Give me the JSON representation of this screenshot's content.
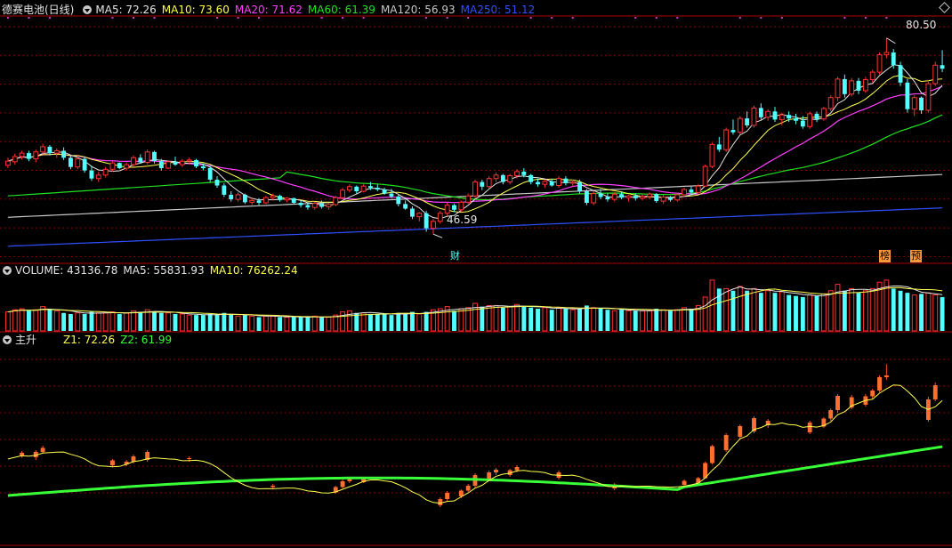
{
  "header_main": {
    "title": "德赛电池(日线)",
    "ma_labels": [
      {
        "text": "MA5: 72.26",
        "color": "#e6e6e6"
      },
      {
        "text": "MA10: 73.60",
        "color": "#ffff50"
      },
      {
        "text": "MA20: 71.62",
        "color": "#ff40ff"
      },
      {
        "text": "MA60: 61.39",
        "color": "#20e020"
      },
      {
        "text": "MA120: 56.93",
        "color": "#c8c8c8"
      },
      {
        "text": "MA250: 51.12",
        "color": "#3050ff"
      }
    ]
  },
  "header_volume": {
    "title": "VOLUME: 43136.78",
    "ma5": "MA5: 55831.93",
    "ma10": "MA10: 76262.24"
  },
  "header_indicator": {
    "title": "主升",
    "z1": "Z1: 72.26",
    "z2": "Z2: 61.99"
  },
  "annotations": {
    "high_label": "80.50",
    "low_label": "46.59",
    "markers": [
      "财",
      "榜",
      "预"
    ]
  },
  "colors": {
    "up": "#ff3232",
    "down": "#54ffff",
    "grid": "#8b0000",
    "border": "#b00000",
    "ma5": "#e6e6e6",
    "ma10": "#ffff50",
    "ma20": "#ff40ff",
    "ma60": "#20e020",
    "ma120": "#c8c8c8",
    "ma250": "#3050ff",
    "z2": "#38ff38"
  },
  "chart_data": {
    "type": "candlestick",
    "title": "德赛电池(日线)",
    "price_range": [
      44,
      84
    ],
    "series": [
      {
        "name": "MA5",
        "last": 72.26
      },
      {
        "name": "MA10",
        "last": 73.6
      },
      {
        "name": "MA20",
        "last": 71.62
      },
      {
        "name": "MA60",
        "last": 61.39
      },
      {
        "name": "MA120",
        "last": 56.93
      },
      {
        "name": "MA250",
        "last": 51.12
      }
    ],
    "ohlc": [
      [
        58.5,
        59.8,
        58.0,
        59.2
      ],
      [
        59.1,
        60.5,
        58.6,
        60.0
      ],
      [
        60.0,
        61.0,
        59.5,
        60.6
      ],
      [
        60.6,
        61.0,
        59.2,
        59.6
      ],
      [
        59.6,
        61.2,
        59.0,
        60.8
      ],
      [
        60.8,
        62.2,
        60.4,
        61.7
      ],
      [
        61.7,
        62.0,
        60.2,
        60.6
      ],
      [
        60.6,
        61.4,
        59.8,
        61.0
      ],
      [
        61.0,
        61.6,
        59.4,
        59.8
      ],
      [
        59.8,
        60.2,
        57.8,
        58.2
      ],
      [
        58.2,
        60.2,
        57.8,
        59.6
      ],
      [
        59.6,
        60.0,
        57.2,
        57.6
      ],
      [
        57.6,
        58.4,
        55.8,
        56.2
      ],
      [
        56.2,
        57.4,
        55.6,
        56.8
      ],
      [
        56.8,
        58.2,
        56.4,
        57.8
      ],
      [
        57.8,
        59.2,
        57.4,
        58.9
      ],
      [
        58.9,
        59.0,
        57.8,
        58.0
      ],
      [
        58.0,
        59.0,
        57.6,
        58.6
      ],
      [
        58.6,
        60.2,
        58.2,
        59.8
      ],
      [
        59.8,
        60.4,
        58.8,
        59.0
      ],
      [
        59.0,
        61.2,
        58.6,
        60.8
      ],
      [
        60.8,
        61.0,
        58.8,
        59.2
      ],
      [
        59.2,
        59.6,
        57.6,
        58.0
      ],
      [
        58.0,
        59.4,
        57.8,
        59.1
      ],
      [
        59.1,
        60.0,
        58.4,
        58.6
      ],
      [
        58.6,
        59.6,
        58.2,
        59.2
      ],
      [
        59.2,
        59.8,
        58.6,
        59.4
      ],
      [
        59.4,
        59.6,
        58.0,
        58.3
      ],
      [
        58.3,
        58.8,
        57.6,
        58.0
      ],
      [
        58.0,
        58.4,
        55.6,
        56.0
      ],
      [
        56.0,
        56.6,
        54.6,
        55.0
      ],
      [
        55.0,
        55.4,
        53.0,
        53.4
      ],
      [
        53.4,
        54.0,
        52.2,
        52.6
      ],
      [
        52.6,
        53.8,
        52.2,
        53.4
      ],
      [
        53.4,
        53.6,
        51.8,
        52.1
      ],
      [
        52.1,
        52.8,
        51.6,
        52.4
      ],
      [
        52.4,
        52.8,
        51.6,
        52.0
      ],
      [
        52.0,
        53.2,
        51.8,
        52.9
      ],
      [
        52.9,
        53.6,
        52.4,
        53.2
      ],
      [
        53.2,
        53.4,
        52.2,
        52.5
      ],
      [
        52.5,
        53.0,
        52.1,
        52.8
      ],
      [
        52.8,
        52.9,
        51.8,
        52.0
      ],
      [
        52.0,
        52.4,
        51.2,
        51.6
      ],
      [
        51.6,
        52.0,
        50.8,
        51.2
      ],
      [
        51.2,
        52.2,
        50.8,
        51.9
      ],
      [
        51.9,
        52.4,
        51.0,
        51.3
      ],
      [
        51.3,
        52.0,
        50.8,
        51.7
      ],
      [
        51.7,
        53.2,
        51.4,
        52.9
      ],
      [
        52.9,
        54.6,
        52.6,
        54.2
      ],
      [
        54.2,
        55.2,
        53.8,
        54.8
      ],
      [
        54.8,
        55.0,
        53.6,
        54.0
      ],
      [
        54.0,
        55.2,
        53.8,
        54.9
      ],
      [
        54.9,
        55.6,
        54.2,
        54.6
      ],
      [
        54.6,
        55.2,
        54.0,
        54.3
      ],
      [
        54.3,
        54.6,
        53.4,
        53.6
      ],
      [
        53.6,
        54.4,
        52.8,
        53.1
      ],
      [
        53.1,
        53.4,
        51.4,
        51.8
      ],
      [
        51.8,
        52.4,
        50.8,
        51.0
      ],
      [
        51.0,
        51.4,
        49.2,
        49.6
      ],
      [
        49.6,
        50.4,
        48.8,
        50.2
      ],
      [
        50.2,
        50.6,
        47.0,
        47.6
      ],
      [
        47.6,
        49.2,
        46.59,
        48.8
      ],
      [
        48.8,
        50.6,
        48.4,
        50.2
      ],
      [
        50.2,
        52.0,
        49.8,
        51.6
      ],
      [
        51.6,
        51.8,
        50.4,
        50.8
      ],
      [
        50.8,
        52.4,
        50.4,
        52.1
      ],
      [
        52.1,
        53.6,
        51.8,
        53.2
      ],
      [
        53.2,
        56.0,
        52.8,
        55.6
      ],
      [
        55.6,
        56.0,
        54.2,
        54.8
      ],
      [
        54.8,
        56.6,
        54.4,
        56.2
      ],
      [
        56.2,
        57.2,
        55.6,
        56.8
      ],
      [
        56.8,
        57.0,
        55.2,
        55.6
      ],
      [
        55.6,
        57.0,
        55.2,
        56.7
      ],
      [
        56.7,
        57.8,
        56.2,
        57.4
      ],
      [
        57.4,
        58.0,
        56.4,
        56.8
      ],
      [
        56.8,
        57.0,
        55.2,
        55.6
      ],
      [
        55.6,
        56.2,
        54.8,
        55.2
      ],
      [
        55.2,
        56.0,
        54.6,
        55.7
      ],
      [
        55.7,
        56.2,
        54.8,
        55.0
      ],
      [
        55.0,
        56.6,
        54.6,
        56.2
      ],
      [
        56.2,
        56.6,
        55.0,
        55.4
      ],
      [
        55.4,
        56.0,
        54.8,
        55.6
      ],
      [
        55.6,
        56.0,
        53.6,
        54.0
      ],
      [
        54.0,
        54.4,
        51.6,
        52.0
      ],
      [
        52.0,
        54.0,
        51.6,
        53.6
      ],
      [
        53.6,
        54.4,
        52.6,
        53.0
      ],
      [
        53.0,
        53.6,
        52.2,
        52.6
      ],
      [
        52.6,
        53.8,
        52.2,
        53.5
      ],
      [
        53.5,
        54.0,
        52.6,
        52.9
      ],
      [
        52.9,
        53.4,
        52.2,
        53.2
      ],
      [
        53.2,
        53.6,
        52.4,
        52.8
      ],
      [
        52.8,
        53.4,
        52.4,
        53.1
      ],
      [
        53.1,
        53.8,
        52.6,
        53.5
      ],
      [
        53.5,
        53.7,
        52.0,
        52.3
      ],
      [
        52.3,
        53.4,
        51.8,
        53.0
      ],
      [
        53.0,
        53.2,
        52.2,
        52.5
      ],
      [
        52.5,
        53.6,
        52.2,
        53.4
      ],
      [
        53.4,
        54.6,
        53.0,
        54.3
      ],
      [
        54.3,
        54.8,
        53.4,
        53.8
      ],
      [
        53.8,
        55.2,
        53.6,
        54.9
      ],
      [
        54.9,
        58.6,
        54.8,
        58.3
      ],
      [
        58.3,
        62.4,
        58.0,
        62.1
      ],
      [
        62.1,
        63.4,
        60.8,
        61.2
      ],
      [
        61.2,
        65.0,
        60.8,
        64.6
      ],
      [
        64.6,
        66.4,
        63.8,
        64.2
      ],
      [
        64.2,
        67.0,
        63.8,
        66.6
      ],
      [
        66.6,
        67.8,
        65.0,
        65.4
      ],
      [
        65.4,
        68.8,
        65.0,
        68.4
      ],
      [
        68.4,
        69.2,
        66.4,
        66.8
      ],
      [
        66.8,
        68.2,
        66.2,
        67.8
      ],
      [
        67.8,
        68.6,
        66.0,
        66.4
      ],
      [
        66.4,
        67.6,
        65.4,
        67.2
      ],
      [
        67.2,
        67.8,
        66.0,
        66.6
      ],
      [
        66.6,
        67.4,
        65.6,
        66.2
      ],
      [
        66.2,
        67.0,
        64.8,
        65.2
      ],
      [
        65.2,
        67.8,
        64.8,
        67.4
      ],
      [
        67.4,
        67.8,
        66.0,
        66.5
      ],
      [
        66.5,
        68.6,
        66.2,
        68.3
      ],
      [
        68.3,
        70.6,
        67.8,
        70.2
      ],
      [
        70.2,
        73.8,
        69.6,
        73.4
      ],
      [
        73.4,
        74.2,
        70.2,
        70.8
      ],
      [
        70.8,
        73.6,
        70.4,
        73.1
      ],
      [
        73.1,
        73.6,
        70.8,
        71.4
      ],
      [
        71.4,
        73.8,
        71.0,
        73.3
      ],
      [
        73.3,
        75.0,
        72.8,
        74.6
      ],
      [
        74.6,
        78.0,
        74.2,
        77.6
      ],
      [
        77.6,
        80.5,
        77.0,
        78.0
      ],
      [
        78.0,
        78.6,
        75.2,
        75.8
      ],
      [
        75.8,
        76.4,
        72.2,
        72.8
      ],
      [
        72.8,
        73.4,
        67.6,
        68.2
      ],
      [
        68.2,
        70.6,
        67.0,
        70.2
      ],
      [
        70.2,
        70.4,
        67.4,
        68.0
      ],
      [
        68.0,
        73.2,
        67.6,
        72.6
      ],
      [
        72.6,
        76.4,
        72.2,
        75.8
      ],
      [
        75.8,
        78.4,
        74.6,
        75.2
      ]
    ],
    "volume": [
      18,
      20,
      21,
      19,
      20,
      23,
      20,
      19,
      17,
      16,
      17,
      16,
      18,
      17,
      17,
      18,
      16,
      17,
      19,
      18,
      20,
      18,
      17,
      17,
      16,
      16,
      15,
      15,
      15,
      16,
      15,
      17,
      16,
      14,
      15,
      14,
      13,
      14,
      14,
      13,
      13,
      13,
      13,
      13,
      14,
      13,
      13,
      15,
      18,
      19,
      17,
      17,
      16,
      16,
      16,
      15,
      17,
      16,
      18,
      16,
      18,
      20,
      21,
      23,
      19,
      21,
      22,
      26,
      23,
      24,
      24,
      22,
      23,
      25,
      23,
      22,
      21,
      22,
      20,
      22,
      21,
      20,
      21,
      24,
      22,
      21,
      20,
      19,
      20,
      19,
      19,
      19,
      19,
      21,
      20,
      19,
      20,
      22,
      21,
      24,
      32,
      48,
      40,
      40,
      38,
      42,
      38,
      40,
      36,
      38,
      36,
      37,
      34,
      33,
      32,
      34,
      33,
      35,
      38,
      44,
      38,
      40,
      36,
      38,
      40,
      46,
      48,
      40,
      38,
      36,
      34,
      35,
      36,
      34,
      32
    ]
  }
}
